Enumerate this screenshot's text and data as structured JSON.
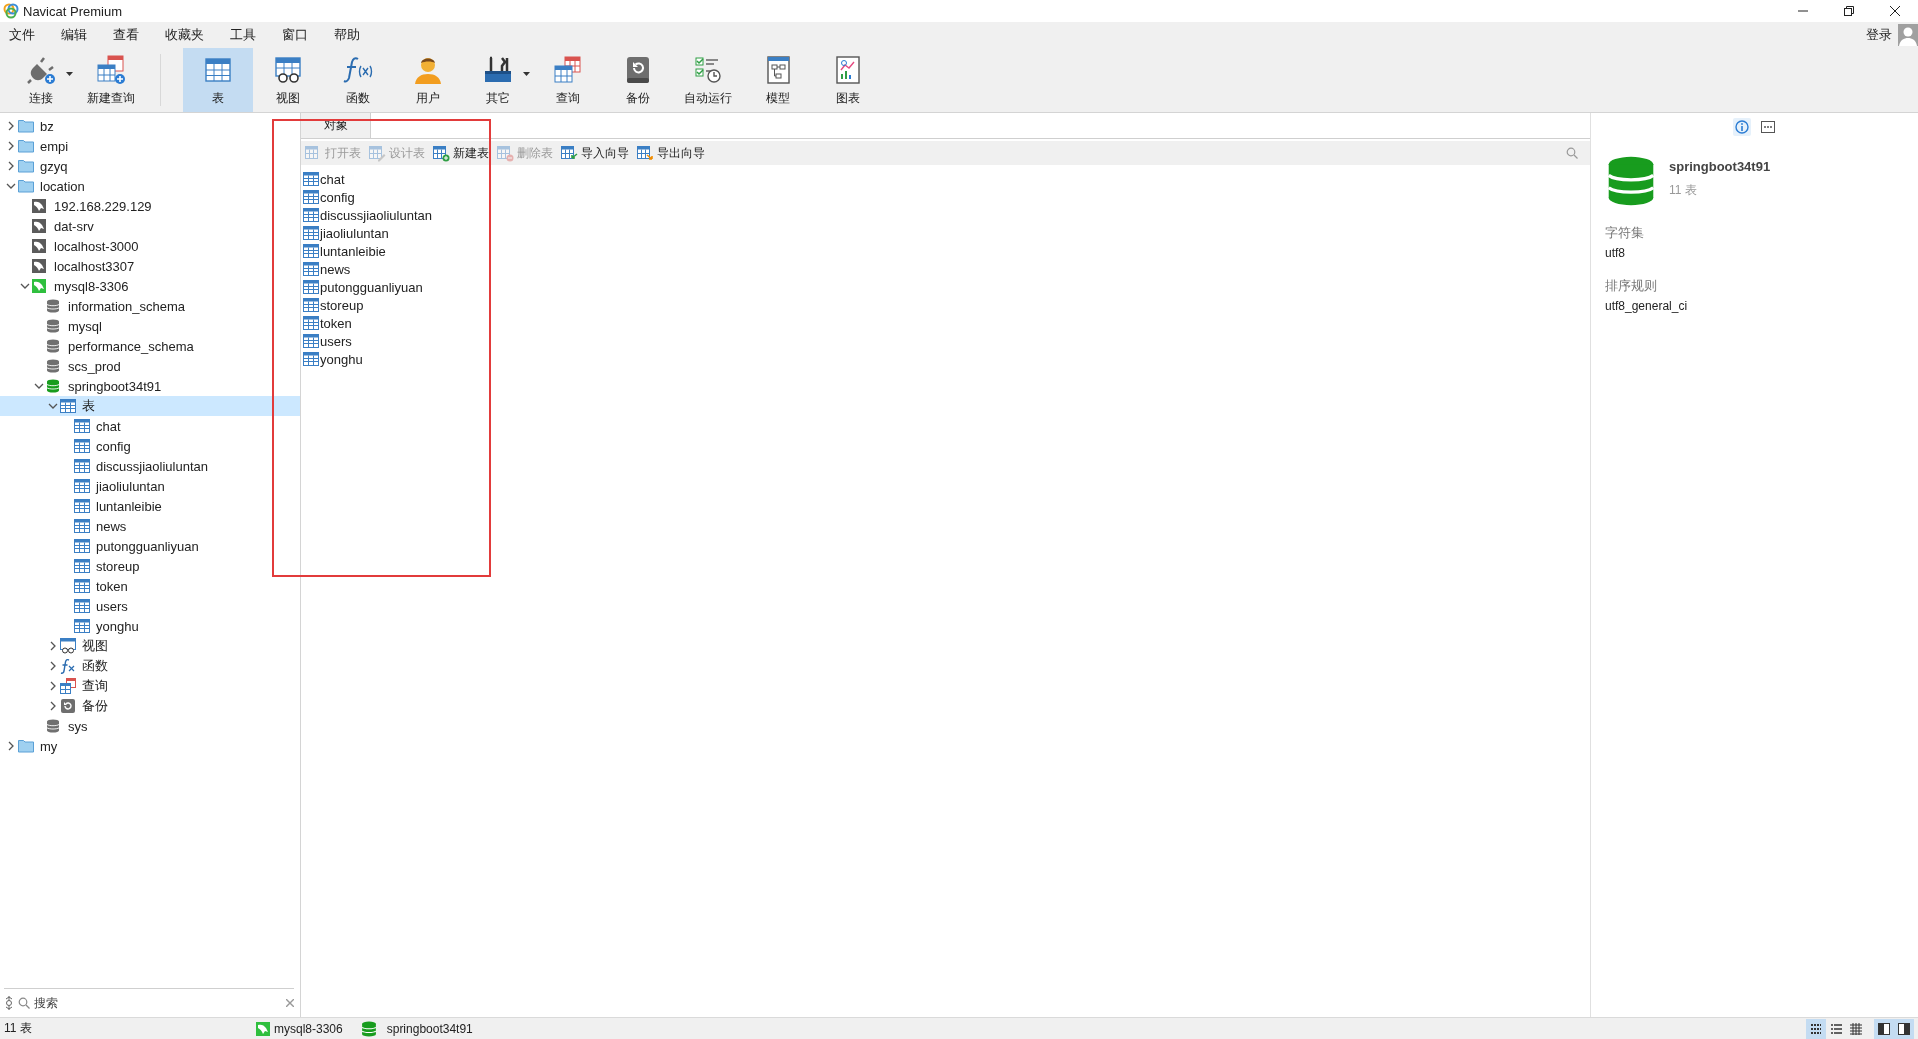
{
  "window": {
    "title": "Navicat Premium"
  },
  "menu": [
    {
      "label": "文件"
    },
    {
      "label": "编辑"
    },
    {
      "label": "查看"
    },
    {
      "label": "收藏夹"
    },
    {
      "label": "工具"
    },
    {
      "label": "窗口"
    },
    {
      "label": "帮助"
    }
  ],
  "account": {
    "label": "登录"
  },
  "toolbar": [
    {
      "label": "连接",
      "kind": "connect",
      "selected": false,
      "dropdown": true
    },
    {
      "label": "新建查询",
      "kind": "new-query",
      "selected": false,
      "dropdown": false,
      "separator_after": true
    },
    {
      "label": "表",
      "kind": "table",
      "selected": true,
      "dropdown": false
    },
    {
      "label": "视图",
      "kind": "view",
      "selected": false,
      "dropdown": false
    },
    {
      "label": "函数",
      "kind": "function",
      "selected": false,
      "dropdown": false
    },
    {
      "label": "用户",
      "kind": "user",
      "selected": false,
      "dropdown": false
    },
    {
      "label": "其它",
      "kind": "other",
      "selected": false,
      "dropdown": true
    },
    {
      "label": "查询",
      "kind": "query",
      "selected": false,
      "dropdown": false
    },
    {
      "label": "备份",
      "kind": "backup",
      "selected": false,
      "dropdown": false
    },
    {
      "label": "自动运行",
      "kind": "automation",
      "selected": false,
      "dropdown": false
    },
    {
      "label": "模型",
      "kind": "model",
      "selected": false,
      "dropdown": false
    },
    {
      "label": "图表",
      "kind": "chart",
      "selected": false,
      "dropdown": false
    }
  ],
  "tree": [
    {
      "label": "bz",
      "kind": "folder",
      "expanded": false,
      "selected": false
    },
    {
      "label": "empi",
      "kind": "folder",
      "expanded": false,
      "selected": false
    },
    {
      "label": "gzyq",
      "kind": "folder",
      "expanded": false,
      "selected": false
    },
    {
      "label": "location",
      "kind": "folder",
      "expanded": true,
      "selected": false,
      "children": [
        {
          "label": "192.168.229.129",
          "kind": "server",
          "connected": false,
          "selected": false
        },
        {
          "label": "dat-srv",
          "kind": "server",
          "connected": false,
          "selected": false
        },
        {
          "label": "localhost-3000",
          "kind": "server",
          "connected": false,
          "selected": false
        },
        {
          "label": "localhost3307",
          "kind": "server",
          "connected": false,
          "selected": false
        },
        {
          "label": "mysql8-3306",
          "kind": "server",
          "connected": true,
          "expanded": true,
          "selected": false,
          "children": [
            {
              "label": "information_schema",
              "kind": "database",
              "open": false,
              "selected": false
            },
            {
              "label": "mysql",
              "kind": "database",
              "open": false,
              "selected": false
            },
            {
              "label": "performance_schema",
              "kind": "database",
              "open": false,
              "selected": false
            },
            {
              "label": "scs_prod",
              "kind": "database",
              "open": false,
              "selected": false
            },
            {
              "label": "springboot34t91",
              "kind": "database",
              "open": true,
              "expanded": true,
              "selected": false,
              "children": [
                {
                  "label": "表",
                  "kind": "tables",
                  "expanded": true,
                  "selected": true,
                  "children": [
                    {
                      "label": "chat",
                      "kind": "table",
                      "selected": false
                    },
                    {
                      "label": "config",
                      "kind": "table",
                      "selected": false
                    },
                    {
                      "label": "discussjiaoliuluntan",
                      "kind": "table",
                      "selected": false
                    },
                    {
                      "label": "jiaoliuluntan",
                      "kind": "table",
                      "selected": false
                    },
                    {
                      "label": "luntanleibie",
                      "kind": "table",
                      "selected": false
                    },
                    {
                      "label": "news",
                      "kind": "table",
                      "selected": false
                    },
                    {
                      "label": "putongguanliyuan",
                      "kind": "table",
                      "selected": false
                    },
                    {
                      "label": "storeup",
                      "kind": "table",
                      "selected": false
                    },
                    {
                      "label": "token",
                      "kind": "table",
                      "selected": false
                    },
                    {
                      "label": "users",
                      "kind": "table",
                      "selected": false
                    },
                    {
                      "label": "yonghu",
                      "kind": "table",
                      "selected": false
                    }
                  ]
                },
                {
                  "label": "视图",
                  "kind": "views",
                  "expanded": false,
                  "selected": false
                },
                {
                  "label": "函数",
                  "kind": "functions",
                  "expanded": false,
                  "selected": false
                },
                {
                  "label": "查询",
                  "kind": "queries",
                  "expanded": false,
                  "selected": false
                },
                {
                  "label": "备份",
                  "kind": "backups",
                  "expanded": false,
                  "selected": false
                }
              ]
            },
            {
              "label": "sys",
              "kind": "database",
              "open": false,
              "selected": false
            }
          ]
        }
      ]
    },
    {
      "label": "my",
      "kind": "folder",
      "expanded": false,
      "selected": false
    }
  ],
  "sidebar_search": {
    "placeholder": "搜索"
  },
  "objects": {
    "tabs": [
      {
        "label": "对象",
        "selected": true
      }
    ],
    "actions": [
      {
        "label": "打开表",
        "kind": "open",
        "disabled": true
      },
      {
        "label": "设计表",
        "kind": "design",
        "disabled": true
      },
      {
        "label": "新建表",
        "kind": "new",
        "disabled": false
      },
      {
        "label": "删除表",
        "kind": "delete",
        "disabled": true
      },
      {
        "label": "导入向导",
        "kind": "import",
        "disabled": false
      },
      {
        "label": "导出向导",
        "kind": "export",
        "disabled": false
      }
    ],
    "items": [
      {
        "label": "chat",
        "selected": false
      },
      {
        "label": "config",
        "selected": false
      },
      {
        "label": "discussjiaoliuluntan",
        "selected": false
      },
      {
        "label": "jiaoliuluntan",
        "selected": false
      },
      {
        "label": "luntanleibie",
        "selected": false
      },
      {
        "label": "news",
        "selected": false
      },
      {
        "label": "putongguanliyuan",
        "selected": false
      },
      {
        "label": "storeup",
        "selected": false
      },
      {
        "label": "token",
        "selected": false
      },
      {
        "label": "users",
        "selected": false
      },
      {
        "label": "yonghu",
        "selected": false
      }
    ]
  },
  "annotation": {
    "kind": "frame"
  },
  "info": {
    "tabs": [
      {
        "kind": "info",
        "selected": true
      },
      {
        "kind": "ddl",
        "selected": false
      }
    ],
    "name": "springboot34t91",
    "subtitle": "11 表",
    "fields": [
      {
        "label": "字符集",
        "value": "utf8"
      },
      {
        "label": "排序规则",
        "value": "utf8_general_ci"
      }
    ]
  },
  "status_bar": {
    "summary": "11 表",
    "connection": "mysql8-3306",
    "database": "springboot34t91",
    "view_modes": [
      {
        "kind": "grid",
        "selected": true
      },
      {
        "kind": "list",
        "selected": false
      },
      {
        "kind": "detail",
        "selected": false
      }
    ],
    "panels": [
      {
        "kind": "left",
        "on": true
      },
      {
        "kind": "right",
        "on": true
      }
    ]
  }
}
